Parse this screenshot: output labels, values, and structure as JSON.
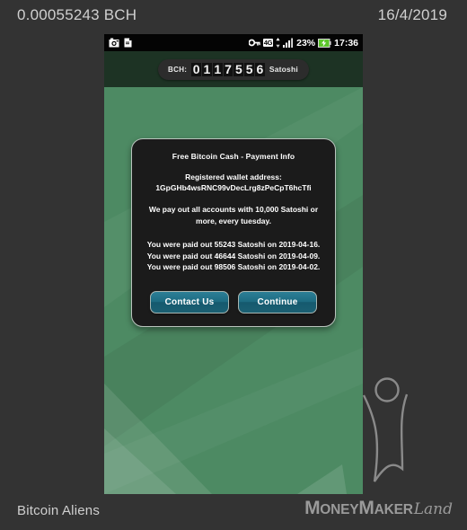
{
  "page_header": {
    "amount": "0.00055243 BCH",
    "date": "16/4/2019"
  },
  "phone": {
    "status_bar": {
      "icons_left": [
        "camera-icon",
        "document-icon"
      ],
      "key_icon": "key-icon",
      "network": "4G",
      "signal_icon": "signal-bars-icon",
      "battery_percent": "23%",
      "battery_icon": "battery-charging-icon",
      "time": "17:36"
    },
    "balance": {
      "label": "BCH:",
      "digits": "0117556",
      "unit": "Satoshi"
    },
    "dialog": {
      "title": "Free Bitcoin Cash - Payment Info",
      "wallet_label": "Registered wallet address:",
      "wallet_address": "1GpGHb4wsRNC99vDecLrg8zPeCpT6hcTfi",
      "payout_note": "We pay out all accounts with 10,000 Satoshi or more, every tuesday.",
      "payouts": [
        "You were paid out 55243 Satoshi on 2019-04-16.",
        "You were paid out 46644 Satoshi on 2019-04-09.",
        "You were paid out 98506 Satoshi on 2019-04-02."
      ],
      "buttons": {
        "contact": "Contact Us",
        "continue": "Continue"
      }
    }
  },
  "footer": {
    "app_name": "Bitcoin Aliens",
    "logo": {
      "m1": "M",
      "oney": "ONEY",
      "m2": "M",
      "aker": "AKER",
      "land": "Land"
    }
  },
  "colors": {
    "page_bg": "#333333",
    "screen_green": "#4d8a63",
    "top_band": "#1d3324",
    "dialog_bg": "#1b1b1b",
    "dialog_border": "#b9c4bd",
    "button_teal": "#1d6b81",
    "status_bar": "#040404",
    "text_light": "#cfcfcf"
  }
}
